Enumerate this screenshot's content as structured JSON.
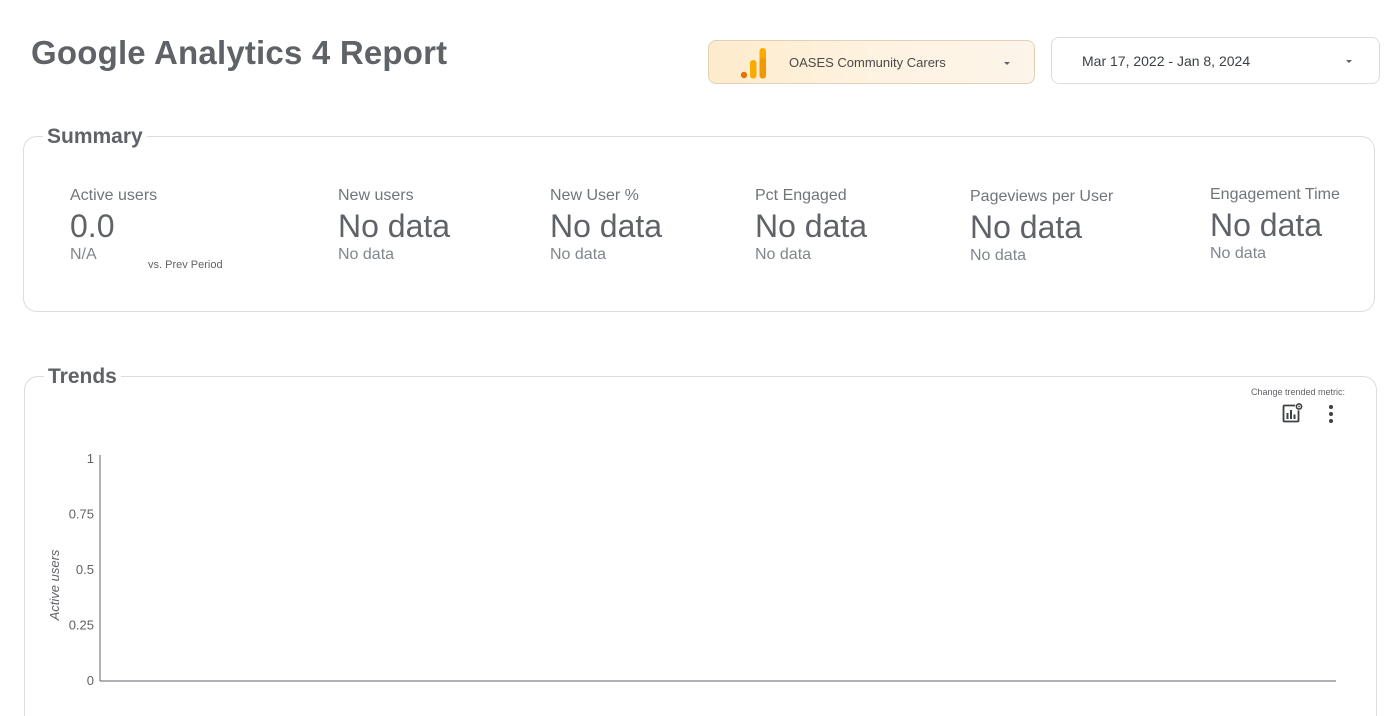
{
  "header": {
    "title": "Google Analytics 4 Report",
    "account_picker": {
      "icon": "google-analytics-logo-icon",
      "label": "OASES Community Carers"
    },
    "date_range": {
      "label": "Mar 17, 2022 - Jan 8, 2024"
    }
  },
  "summary": {
    "title": "Summary",
    "metrics": [
      {
        "label": "Active users",
        "value": "0.0",
        "sub": "N/A",
        "compare": "vs. Prev Period"
      },
      {
        "label": "New users",
        "value": "No data",
        "sub": "No data"
      },
      {
        "label": "New User %",
        "value": "No data",
        "sub": "No data"
      },
      {
        "label": "Pct Engaged",
        "value": "No data",
        "sub": "No data"
      },
      {
        "label": "Pageviews per User",
        "value": "No data",
        "sub": "No data"
      },
      {
        "label": "Engagement Time",
        "value": "No data",
        "sub": "No data"
      }
    ]
  },
  "trends": {
    "title": "Trends",
    "change_metric_label": "Change trended metric:",
    "icons": [
      "chart-settings-icon",
      "more-vertical-icon"
    ],
    "chart_data": {
      "type": "line",
      "ylabel": "Active users",
      "xlabel": "",
      "ylim": [
        0,
        1
      ],
      "yticks": [
        "1",
        "0.75",
        "0.5",
        "0.25",
        "0"
      ],
      "series": []
    }
  },
  "colors": {
    "ga_orange": "#F9AB00",
    "ga_dark_orange": "#E37400",
    "text_gray": "#5f6368",
    "border": "#dadce0"
  }
}
